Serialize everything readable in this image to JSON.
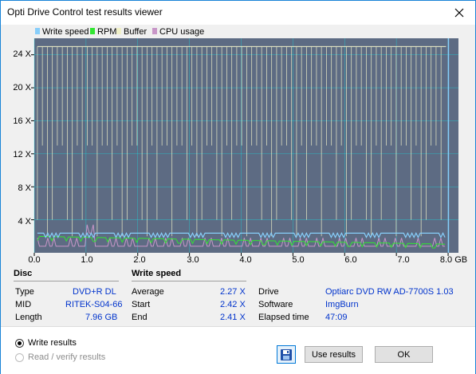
{
  "window": {
    "title": "Opti Drive Control test results viewer"
  },
  "chart_data": {
    "type": "line",
    "legend": [
      "Write speed",
      "RPM",
      "Buffer",
      "CPU usage"
    ],
    "colors": {
      "write_speed": "#87cefa",
      "rpm": "#32e632",
      "buffer": "#f0f0c8",
      "cpu": "#c896c8",
      "plot_bg": "#5d6b83",
      "grid": "#00ffff"
    },
    "y_ticks": [
      "24 X",
      "20 X",
      "16 X",
      "12 X",
      "8 X",
      "4 X"
    ],
    "x_ticks": [
      "0.0",
      "1.0",
      "2.0",
      "3.0",
      "4.0",
      "5.0",
      "6.0",
      "7.0",
      "8.0 GB"
    ],
    "xlim": [
      0,
      8.2
    ],
    "ylim": [
      0,
      26
    ],
    "write_speed_avg": 2.27,
    "write_speed_start": 2.42,
    "write_speed_end": 2.41,
    "buffer_level": 25
  },
  "disc": {
    "header": "Disc",
    "type_label": "Type",
    "type_value": "DVD+R DL",
    "mid_label": "MID",
    "mid_value": "RITEK-S04-66",
    "length_label": "Length",
    "length_value": "7.96 GB"
  },
  "write_speed": {
    "header": "Write speed",
    "average_label": "Average",
    "average_value": "2.27 X",
    "start_label": "Start",
    "start_value": "2.42 X",
    "end_label": "End",
    "end_value": "2.41 X"
  },
  "drive": {
    "drive_label": "Drive",
    "drive_value": "Optiarc  DVD RW AD-7700S 1.03",
    "software_label": "Software",
    "software_value": "ImgBurn",
    "elapsed_label": "Elapsed time",
    "elapsed_value": "47:09"
  },
  "options": {
    "write_results": "Write results",
    "read_verify_results": "Read / verify results"
  },
  "buttons": {
    "use_results": "Use results",
    "ok": "OK"
  }
}
